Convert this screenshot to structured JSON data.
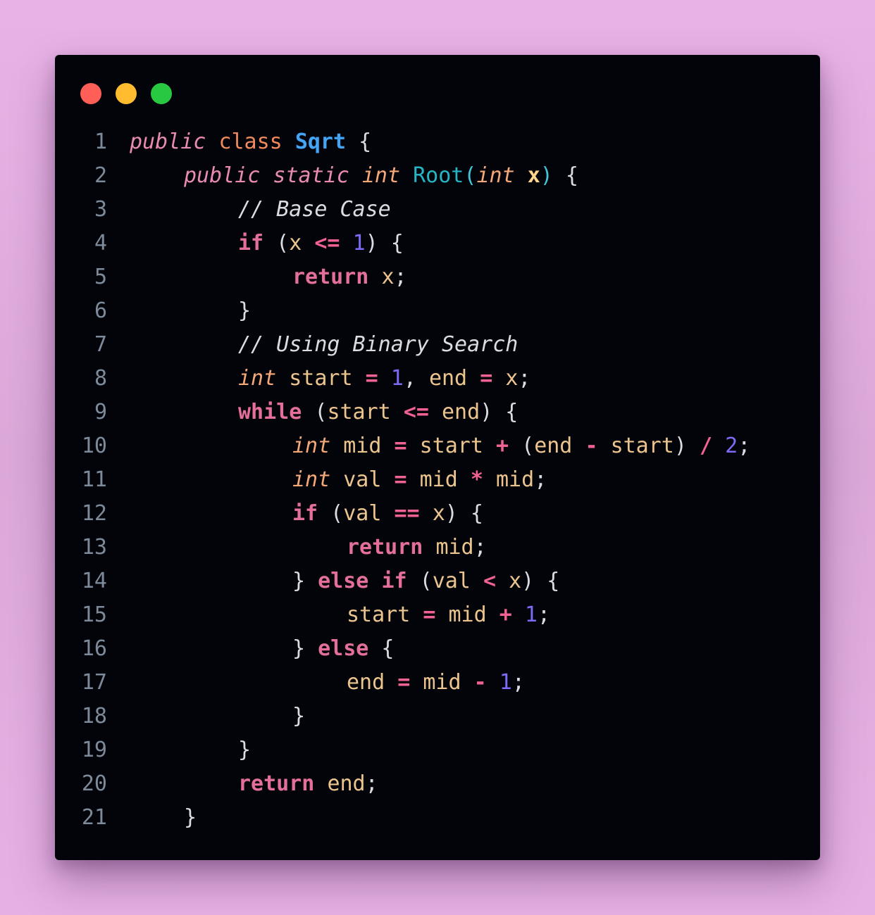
{
  "window": {
    "buttons": [
      {
        "name": "close-dot",
        "color": "#ff5f57"
      },
      {
        "name": "minimize-dot",
        "color": "#febc2e"
      },
      {
        "name": "maximize-dot",
        "color": "#28c840"
      }
    ]
  },
  "theme": {
    "keyword": "#e36f9a",
    "modifier": "#e88ab4",
    "class_kw": "#f08a5d",
    "class_name": "#42a5f5",
    "method_name": "#26b5c5",
    "type": "#f5a877",
    "identifier": "#ecc48d",
    "number": "#7b6cf6",
    "operator": "#f06292",
    "comment": "#d9dde3",
    "punctuation": "#d9dde3",
    "paren": "#43c6d8",
    "param": "#ffd58a"
  },
  "code": {
    "lines": [
      {
        "num": "1",
        "indent": 0,
        "tokens": [
          {
            "t": "public",
            "s": "modifier",
            "i": true
          },
          {
            "t": " ",
            "s": "punctuation"
          },
          {
            "t": "class",
            "s": "class_kw"
          },
          {
            "t": " ",
            "s": "punctuation"
          },
          {
            "t": "Sqrt",
            "s": "class_name",
            "b": true
          },
          {
            "t": " {",
            "s": "punctuation"
          }
        ]
      },
      {
        "num": "2",
        "indent": 1,
        "tokens": [
          {
            "t": "public",
            "s": "modifier",
            "i": true
          },
          {
            "t": " ",
            "s": "punctuation"
          },
          {
            "t": "static",
            "s": "modifier",
            "i": true
          },
          {
            "t": " ",
            "s": "punctuation"
          },
          {
            "t": "int",
            "s": "type",
            "i": true
          },
          {
            "t": " ",
            "s": "punctuation"
          },
          {
            "t": "Root",
            "s": "method_name"
          },
          {
            "t": "(",
            "s": "paren"
          },
          {
            "t": "int",
            "s": "type",
            "i": true
          },
          {
            "t": " ",
            "s": "punctuation"
          },
          {
            "t": "x",
            "s": "param",
            "b": true
          },
          {
            "t": ")",
            "s": "paren"
          },
          {
            "t": " {",
            "s": "punctuation"
          }
        ]
      },
      {
        "num": "3",
        "indent": 2,
        "tokens": [
          {
            "t": "// Base Case",
            "s": "comment",
            "i": true
          }
        ]
      },
      {
        "num": "4",
        "indent": 2,
        "tokens": [
          {
            "t": "if",
            "s": "keyword",
            "b": true
          },
          {
            "t": " (",
            "s": "punctuation"
          },
          {
            "t": "x",
            "s": "identifier"
          },
          {
            "t": " ",
            "s": "punctuation"
          },
          {
            "t": "<=",
            "s": "operator",
            "b": true
          },
          {
            "t": " ",
            "s": "punctuation"
          },
          {
            "t": "1",
            "s": "number"
          },
          {
            "t": ") {",
            "s": "punctuation"
          }
        ]
      },
      {
        "num": "5",
        "indent": 3,
        "tokens": [
          {
            "t": "return",
            "s": "keyword",
            "b": true
          },
          {
            "t": " ",
            "s": "punctuation"
          },
          {
            "t": "x",
            "s": "identifier"
          },
          {
            "t": ";",
            "s": "punctuation"
          }
        ]
      },
      {
        "num": "6",
        "indent": 2,
        "tokens": [
          {
            "t": "}",
            "s": "punctuation"
          }
        ]
      },
      {
        "num": "7",
        "indent": 2,
        "tokens": [
          {
            "t": "// Using Binary Search",
            "s": "comment",
            "i": true
          }
        ]
      },
      {
        "num": "8",
        "indent": 2,
        "tokens": [
          {
            "t": "int",
            "s": "type",
            "i": true
          },
          {
            "t": " ",
            "s": "punctuation"
          },
          {
            "t": "start",
            "s": "identifier"
          },
          {
            "t": " ",
            "s": "punctuation"
          },
          {
            "t": "=",
            "s": "operator",
            "b": true
          },
          {
            "t": " ",
            "s": "punctuation"
          },
          {
            "t": "1",
            "s": "number"
          },
          {
            "t": ", ",
            "s": "punctuation"
          },
          {
            "t": "end",
            "s": "identifier"
          },
          {
            "t": " ",
            "s": "punctuation"
          },
          {
            "t": "=",
            "s": "operator",
            "b": true
          },
          {
            "t": " ",
            "s": "punctuation"
          },
          {
            "t": "x",
            "s": "identifier"
          },
          {
            "t": ";",
            "s": "punctuation"
          }
        ]
      },
      {
        "num": "9",
        "indent": 2,
        "tokens": [
          {
            "t": "while",
            "s": "keyword",
            "b": true
          },
          {
            "t": " (",
            "s": "punctuation"
          },
          {
            "t": "start",
            "s": "identifier"
          },
          {
            "t": " ",
            "s": "punctuation"
          },
          {
            "t": "<=",
            "s": "operator",
            "b": true
          },
          {
            "t": " ",
            "s": "punctuation"
          },
          {
            "t": "end",
            "s": "identifier"
          },
          {
            "t": ") {",
            "s": "punctuation"
          }
        ]
      },
      {
        "num": "10",
        "indent": 3,
        "tokens": [
          {
            "t": "int",
            "s": "type",
            "i": true
          },
          {
            "t": " ",
            "s": "punctuation"
          },
          {
            "t": "mid",
            "s": "identifier"
          },
          {
            "t": " ",
            "s": "punctuation"
          },
          {
            "t": "=",
            "s": "operator",
            "b": true
          },
          {
            "t": " ",
            "s": "punctuation"
          },
          {
            "t": "start",
            "s": "identifier"
          },
          {
            "t": " ",
            "s": "punctuation"
          },
          {
            "t": "+",
            "s": "operator",
            "b": true
          },
          {
            "t": " (",
            "s": "punctuation"
          },
          {
            "t": "end",
            "s": "identifier"
          },
          {
            "t": " ",
            "s": "punctuation"
          },
          {
            "t": "-",
            "s": "operator",
            "b": true
          },
          {
            "t": " ",
            "s": "punctuation"
          },
          {
            "t": "start",
            "s": "identifier"
          },
          {
            "t": ") ",
            "s": "punctuation"
          },
          {
            "t": "/",
            "s": "operator",
            "b": true
          },
          {
            "t": " ",
            "s": "punctuation"
          },
          {
            "t": "2",
            "s": "number"
          },
          {
            "t": ";",
            "s": "punctuation"
          }
        ]
      },
      {
        "num": "11",
        "indent": 3,
        "tokens": [
          {
            "t": "int",
            "s": "type",
            "i": true
          },
          {
            "t": " ",
            "s": "punctuation"
          },
          {
            "t": "val",
            "s": "identifier"
          },
          {
            "t": " ",
            "s": "punctuation"
          },
          {
            "t": "=",
            "s": "operator",
            "b": true
          },
          {
            "t": " ",
            "s": "punctuation"
          },
          {
            "t": "mid",
            "s": "identifier"
          },
          {
            "t": " ",
            "s": "punctuation"
          },
          {
            "t": "*",
            "s": "operator",
            "b": true
          },
          {
            "t": " ",
            "s": "punctuation"
          },
          {
            "t": "mid",
            "s": "identifier"
          },
          {
            "t": ";",
            "s": "punctuation"
          }
        ]
      },
      {
        "num": "12",
        "indent": 3,
        "tokens": [
          {
            "t": "if",
            "s": "keyword",
            "b": true
          },
          {
            "t": " (",
            "s": "punctuation"
          },
          {
            "t": "val",
            "s": "identifier"
          },
          {
            "t": " ",
            "s": "punctuation"
          },
          {
            "t": "==",
            "s": "operator",
            "b": true
          },
          {
            "t": " ",
            "s": "punctuation"
          },
          {
            "t": "x",
            "s": "identifier"
          },
          {
            "t": ") {",
            "s": "punctuation"
          }
        ]
      },
      {
        "num": "13",
        "indent": 4,
        "tokens": [
          {
            "t": "return",
            "s": "keyword",
            "b": true
          },
          {
            "t": " ",
            "s": "punctuation"
          },
          {
            "t": "mid",
            "s": "identifier"
          },
          {
            "t": ";",
            "s": "punctuation"
          }
        ]
      },
      {
        "num": "14",
        "indent": 3,
        "tokens": [
          {
            "t": "} ",
            "s": "punctuation"
          },
          {
            "t": "else",
            "s": "keyword",
            "b": true
          },
          {
            "t": " ",
            "s": "punctuation"
          },
          {
            "t": "if",
            "s": "keyword",
            "b": true
          },
          {
            "t": " (",
            "s": "punctuation"
          },
          {
            "t": "val",
            "s": "identifier"
          },
          {
            "t": " ",
            "s": "punctuation"
          },
          {
            "t": "<",
            "s": "operator",
            "b": true
          },
          {
            "t": " ",
            "s": "punctuation"
          },
          {
            "t": "x",
            "s": "identifier"
          },
          {
            "t": ") {",
            "s": "punctuation"
          }
        ]
      },
      {
        "num": "15",
        "indent": 4,
        "tokens": [
          {
            "t": "start",
            "s": "identifier"
          },
          {
            "t": " ",
            "s": "punctuation"
          },
          {
            "t": "=",
            "s": "operator",
            "b": true
          },
          {
            "t": " ",
            "s": "punctuation"
          },
          {
            "t": "mid",
            "s": "identifier"
          },
          {
            "t": " ",
            "s": "punctuation"
          },
          {
            "t": "+",
            "s": "operator",
            "b": true
          },
          {
            "t": " ",
            "s": "punctuation"
          },
          {
            "t": "1",
            "s": "number"
          },
          {
            "t": ";",
            "s": "punctuation"
          }
        ]
      },
      {
        "num": "16",
        "indent": 3,
        "tokens": [
          {
            "t": "} ",
            "s": "punctuation"
          },
          {
            "t": "else",
            "s": "keyword",
            "b": true
          },
          {
            "t": " {",
            "s": "punctuation"
          }
        ]
      },
      {
        "num": "17",
        "indent": 4,
        "tokens": [
          {
            "t": "end",
            "s": "identifier"
          },
          {
            "t": " ",
            "s": "punctuation"
          },
          {
            "t": "=",
            "s": "operator",
            "b": true
          },
          {
            "t": " ",
            "s": "punctuation"
          },
          {
            "t": "mid",
            "s": "identifier"
          },
          {
            "t": " ",
            "s": "punctuation"
          },
          {
            "t": "-",
            "s": "operator",
            "b": true
          },
          {
            "t": " ",
            "s": "punctuation"
          },
          {
            "t": "1",
            "s": "number"
          },
          {
            "t": ";",
            "s": "punctuation"
          }
        ]
      },
      {
        "num": "18",
        "indent": 3,
        "tokens": [
          {
            "t": "}",
            "s": "punctuation"
          }
        ]
      },
      {
        "num": "19",
        "indent": 2,
        "tokens": [
          {
            "t": "}",
            "s": "punctuation"
          }
        ]
      },
      {
        "num": "20",
        "indent": 2,
        "tokens": [
          {
            "t": "return",
            "s": "keyword",
            "b": true
          },
          {
            "t": " ",
            "s": "punctuation"
          },
          {
            "t": "end",
            "s": "identifier"
          },
          {
            "t": ";",
            "s": "punctuation"
          }
        ]
      },
      {
        "num": "21",
        "indent": 1,
        "tokens": [
          {
            "t": "}",
            "s": "punctuation"
          }
        ]
      }
    ]
  }
}
